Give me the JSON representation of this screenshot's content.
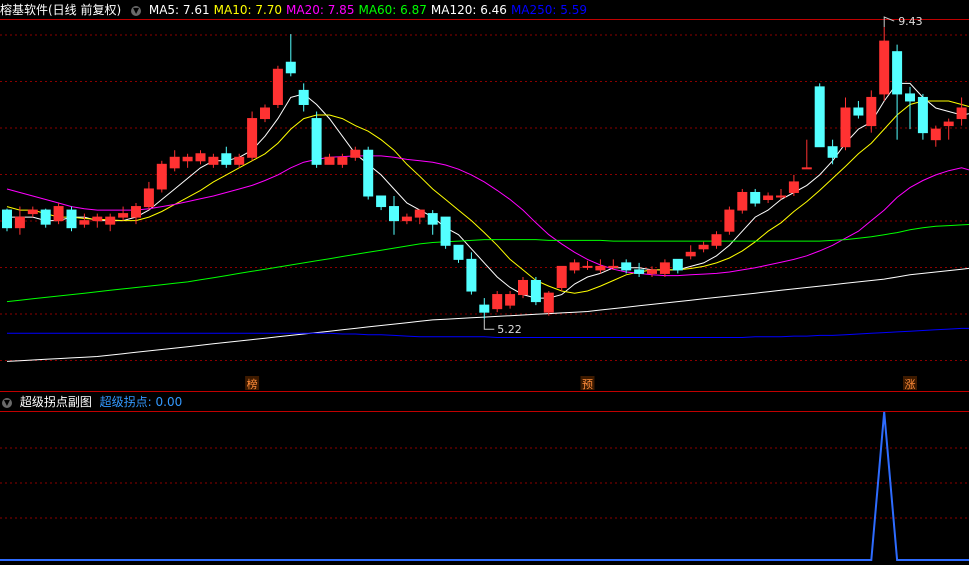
{
  "main_header": {
    "title": "榕基软件(日线 前复权)",
    "ma": [
      {
        "label": "MA5: 7.61",
        "color": "#ffffff"
      },
      {
        "label": "MA10: 7.70",
        "color": "#ffff00"
      },
      {
        "label": "MA20: 7.85",
        "color": "#ff00ff"
      },
      {
        "label": "MA60: 6.87",
        "color": "#00ff00"
      },
      {
        "label": "MA120: 6.46",
        "color": "#ffffff"
      },
      {
        "label": "MA250: 5.59",
        "color": "#0000ff"
      }
    ]
  },
  "sub_header": {
    "title": "超级拐点副图",
    "indicator": "超级拐点: 0.00",
    "indicator_color": "#3399ff"
  },
  "annotations": {
    "high_label": "9.43",
    "low_label": "5.22",
    "markers": [
      "榜",
      "预",
      "涨"
    ]
  },
  "colors": {
    "up": "#ff3232",
    "down": "#54ffff",
    "grid": "#8b0000",
    "divider": "#c00000",
    "marker_bg": "#3d1a00",
    "marker_text": "#ff8c3a",
    "indicator_line": "#2e6cff"
  },
  "chart_data": {
    "type": "candlestick",
    "y_scale": {
      "top_price": 10.0,
      "bottom_price": 5.0
    },
    "candles": [
      [
        7.3,
        7.05,
        7.32,
        7.0
      ],
      [
        7.05,
        7.2,
        7.35,
        6.95
      ],
      [
        7.25,
        7.3,
        7.35,
        7.2
      ],
      [
        7.3,
        7.1,
        7.32,
        7.05
      ],
      [
        7.15,
        7.35,
        7.4,
        7.1
      ],
      [
        7.3,
        7.05,
        7.35,
        7.0
      ],
      [
        7.1,
        7.15,
        7.25,
        7.05
      ],
      [
        7.15,
        7.2,
        7.25,
        7.05
      ],
      [
        7.1,
        7.2,
        7.25,
        7.0
      ],
      [
        7.2,
        7.25,
        7.35,
        7.15
      ],
      [
        7.2,
        7.35,
        7.4,
        7.1
      ],
      [
        7.35,
        7.6,
        7.7,
        7.3
      ],
      [
        7.6,
        7.95,
        8.0,
        7.55
      ],
      [
        7.9,
        8.05,
        8.15,
        7.85
      ],
      [
        8.0,
        8.05,
        8.1,
        7.9
      ],
      [
        8.0,
        8.1,
        8.15,
        7.95
      ],
      [
        7.95,
        8.05,
        8.1,
        7.9
      ],
      [
        8.1,
        7.95,
        8.2,
        7.9
      ],
      [
        7.95,
        8.05,
        8.1,
        7.9
      ],
      [
        8.05,
        8.6,
        8.7,
        8.0
      ],
      [
        8.6,
        8.75,
        8.8,
        8.55
      ],
      [
        8.8,
        9.3,
        9.35,
        8.75
      ],
      [
        9.4,
        9.25,
        9.8,
        9.2
      ],
      [
        9.0,
        8.8,
        9.1,
        8.7
      ],
      [
        8.6,
        7.95,
        8.7,
        7.9
      ],
      [
        7.95,
        8.05,
        8.1,
        7.95
      ],
      [
        7.95,
        8.05,
        8.1,
        7.9
      ],
      [
        8.05,
        8.15,
        8.2,
        8.0
      ],
      [
        8.15,
        7.5,
        8.2,
        7.45
      ],
      [
        7.5,
        7.35,
        7.5,
        7.3
      ],
      [
        7.35,
        7.15,
        7.5,
        6.95
      ],
      [
        7.15,
        7.2,
        7.25,
        7.1
      ],
      [
        7.2,
        7.3,
        7.3,
        7.1
      ],
      [
        7.25,
        7.1,
        7.3,
        6.95
      ],
      [
        7.2,
        6.8,
        7.2,
        6.75
      ],
      [
        6.8,
        6.6,
        6.8,
        6.55
      ],
      [
        6.6,
        6.15,
        6.7,
        6.1
      ],
      [
        5.95,
        5.85,
        6.05,
        5.75
      ],
      [
        5.9,
        6.1,
        6.15,
        5.85
      ],
      [
        5.95,
        6.1,
        6.15,
        5.9
      ],
      [
        6.1,
        6.3,
        6.35,
        6.05
      ],
      [
        6.3,
        6.0,
        6.35,
        5.95
      ],
      [
        5.85,
        6.12,
        6.15,
        5.8
      ],
      [
        6.2,
        6.5,
        6.5,
        6.15
      ],
      [
        6.45,
        6.55,
        6.6,
        6.4
      ],
      [
        6.5,
        6.5,
        6.58,
        6.45
      ],
      [
        6.45,
        6.5,
        6.6,
        6.4
      ],
      [
        6.5,
        6.5,
        6.6,
        6.45
      ],
      [
        6.55,
        6.45,
        6.6,
        6.4
      ],
      [
        6.45,
        6.4,
        6.55,
        6.35
      ],
      [
        6.4,
        6.45,
        6.5,
        6.35
      ],
      [
        6.4,
        6.55,
        6.6,
        6.35
      ],
      [
        6.6,
        6.45,
        6.6,
        6.4
      ],
      [
        6.65,
        6.7,
        6.8,
        6.6
      ],
      [
        6.75,
        6.8,
        6.85,
        6.7
      ],
      [
        6.8,
        6.95,
        7.0,
        6.75
      ],
      [
        7.0,
        7.3,
        7.35,
        6.95
      ],
      [
        7.3,
        7.55,
        7.6,
        7.25
      ],
      [
        7.55,
        7.4,
        7.6,
        7.35
      ],
      [
        7.45,
        7.5,
        7.55,
        7.4
      ],
      [
        7.5,
        7.5,
        7.6,
        7.45
      ],
      [
        7.55,
        7.7,
        7.8,
        7.5
      ],
      [
        7.9,
        7.9,
        8.3,
        7.9
      ],
      [
        9.05,
        8.2,
        9.1,
        8.2
      ],
      [
        8.2,
        8.05,
        8.3,
        7.95
      ],
      [
        8.2,
        8.75,
        8.9,
        8.15
      ],
      [
        8.75,
        8.65,
        8.85,
        8.6
      ],
      [
        8.5,
        8.9,
        9.0,
        8.4
      ],
      [
        8.95,
        9.7,
        9.9,
        8.85
      ],
      [
        9.55,
        8.95,
        9.65,
        8.3
      ],
      [
        8.95,
        8.85,
        9.05,
        8.45
      ],
      [
        8.9,
        8.4,
        8.95,
        8.3
      ],
      [
        8.3,
        8.45,
        8.5,
        8.2
      ],
      [
        8.5,
        8.55,
        8.6,
        8.3
      ],
      [
        8.6,
        8.75,
        8.9,
        8.5
      ],
      [
        8.75,
        8.8,
        8.95,
        8.55
      ]
    ],
    "ma_lines": {
      "MA5": [
        7.2,
        7.2,
        7.2,
        7.15,
        7.15,
        7.2,
        7.2,
        7.15,
        7.15,
        7.15,
        7.2,
        7.3,
        7.45,
        7.6,
        7.75,
        7.9,
        8.0,
        8.0,
        8.05,
        8.15,
        8.35,
        8.6,
        8.9,
        8.95,
        8.8,
        8.6,
        8.35,
        8.1,
        7.95,
        7.8,
        7.6,
        7.4,
        7.3,
        7.2,
        7.05,
        6.95,
        6.75,
        6.55,
        6.35,
        6.2,
        6.1,
        6.05,
        6.05,
        6.1,
        6.25,
        6.35,
        6.4,
        6.48,
        6.48,
        6.48,
        6.45,
        6.45,
        6.45,
        6.5,
        6.55,
        6.65,
        6.8,
        7.0,
        7.2,
        7.3,
        7.45,
        7.55,
        7.65,
        7.8,
        8.0,
        8.25,
        8.45,
        8.55,
        8.85,
        9.1,
        9.1,
        8.9,
        8.75,
        8.7,
        8.65,
        8.68
      ],
      "MA10": [
        7.35,
        7.3,
        7.3,
        7.25,
        7.2,
        7.2,
        7.18,
        7.17,
        7.16,
        7.15,
        7.15,
        7.2,
        7.28,
        7.38,
        7.48,
        7.58,
        7.7,
        7.8,
        7.9,
        8.0,
        8.1,
        8.25,
        8.45,
        8.6,
        8.65,
        8.65,
        8.6,
        8.5,
        8.42,
        8.3,
        8.15,
        7.95,
        7.78,
        7.6,
        7.45,
        7.3,
        7.15,
        6.98,
        6.8,
        6.6,
        6.45,
        6.3,
        6.22,
        6.15,
        6.12,
        6.15,
        6.22,
        6.3,
        6.38,
        6.42,
        6.45,
        6.45,
        6.45,
        6.47,
        6.5,
        6.55,
        6.62,
        6.72,
        6.85,
        7.0,
        7.12,
        7.28,
        7.42,
        7.58,
        7.75,
        7.92,
        8.1,
        8.25,
        8.45,
        8.65,
        8.8,
        8.85,
        8.85,
        8.85,
        8.8,
        8.75
      ],
      "MA20": [
        7.6,
        7.55,
        7.5,
        7.45,
        7.4,
        7.35,
        7.32,
        7.3,
        7.3,
        7.3,
        7.3,
        7.32,
        7.35,
        7.38,
        7.42,
        7.46,
        7.5,
        7.55,
        7.6,
        7.65,
        7.72,
        7.8,
        7.9,
        7.98,
        8.02,
        8.05,
        8.06,
        8.07,
        8.07,
        8.07,
        8.05,
        8.02,
        8.0,
        7.98,
        7.94,
        7.88,
        7.8,
        7.7,
        7.58,
        7.45,
        7.3,
        7.12,
        6.95,
        6.82,
        6.7,
        6.6,
        6.52,
        6.46,
        6.42,
        6.4,
        6.38,
        6.37,
        6.37,
        6.38,
        6.39,
        6.4,
        6.42,
        6.45,
        6.48,
        6.52,
        6.56,
        6.6,
        6.65,
        6.72,
        6.8,
        6.9,
        7.0,
        7.15,
        7.3,
        7.48,
        7.62,
        7.72,
        7.8,
        7.86,
        7.9,
        7.85
      ],
      "MA60": [
        6.0,
        6.02,
        6.04,
        6.06,
        6.08,
        6.1,
        6.12,
        6.14,
        6.16,
        6.18,
        6.2,
        6.22,
        6.24,
        6.26,
        6.28,
        6.31,
        6.34,
        6.37,
        6.4,
        6.43,
        6.46,
        6.49,
        6.52,
        6.55,
        6.58,
        6.61,
        6.64,
        6.67,
        6.7,
        6.73,
        6.76,
        6.79,
        6.82,
        6.84,
        6.85,
        6.86,
        6.87,
        6.88,
        6.88,
        6.88,
        6.88,
        6.88,
        6.87,
        6.87,
        6.87,
        6.87,
        6.87,
        6.86,
        6.86,
        6.86,
        6.86,
        6.86,
        6.86,
        6.86,
        6.86,
        6.86,
        6.86,
        6.86,
        6.86,
        6.86,
        6.86,
        6.86,
        6.86,
        6.86,
        6.87,
        6.88,
        6.9,
        6.92,
        6.95,
        6.98,
        7.02,
        7.05,
        7.07,
        7.08,
        7.09,
        7.1
      ],
      "MA120": [
        5.15,
        5.16,
        5.17,
        5.18,
        5.19,
        5.2,
        5.21,
        5.22,
        5.24,
        5.26,
        5.28,
        5.3,
        5.32,
        5.34,
        5.36,
        5.38,
        5.4,
        5.42,
        5.44,
        5.46,
        5.48,
        5.5,
        5.52,
        5.54,
        5.56,
        5.58,
        5.6,
        5.62,
        5.64,
        5.66,
        5.68,
        5.7,
        5.72,
        5.74,
        5.75,
        5.76,
        5.77,
        5.78,
        5.79,
        5.8,
        5.81,
        5.82,
        5.83,
        5.84,
        5.85,
        5.86,
        5.88,
        5.9,
        5.92,
        5.94,
        5.96,
        5.98,
        6.0,
        6.02,
        6.04,
        6.06,
        6.08,
        6.1,
        6.12,
        6.14,
        6.16,
        6.18,
        6.2,
        6.22,
        6.24,
        6.26,
        6.28,
        6.3,
        6.32,
        6.35,
        6.38,
        6.4,
        6.42,
        6.44,
        6.46,
        6.48
      ],
      "MA250": [
        5.55,
        5.55,
        5.55,
        5.55,
        5.55,
        5.55,
        5.55,
        5.55,
        5.55,
        5.55,
        5.55,
        5.55,
        5.55,
        5.55,
        5.55,
        5.55,
        5.55,
        5.55,
        5.55,
        5.55,
        5.55,
        5.55,
        5.55,
        5.55,
        5.55,
        5.55,
        5.54,
        5.54,
        5.53,
        5.53,
        5.52,
        5.51,
        5.5,
        5.5,
        5.5,
        5.5,
        5.5,
        5.5,
        5.49,
        5.49,
        5.49,
        5.49,
        5.49,
        5.49,
        5.49,
        5.49,
        5.49,
        5.49,
        5.49,
        5.49,
        5.49,
        5.49,
        5.49,
        5.49,
        5.49,
        5.49,
        5.49,
        5.49,
        5.5,
        5.5,
        5.5,
        5.51,
        5.51,
        5.52,
        5.52,
        5.53,
        5.54,
        5.55,
        5.56,
        5.57,
        5.58,
        5.59,
        5.6,
        5.61,
        5.62,
        5.62
      ]
    },
    "ma_colors": {
      "MA5": "#ffffff",
      "MA10": "#ffff00",
      "MA20": "#ff00ff",
      "MA60": "#00ff00",
      "MA120": "#ffffff",
      "MA250": "#0000ff"
    },
    "marker_candle_index": [
      19,
      45,
      70
    ],
    "high_candle_index": 68,
    "low_candle_index": 37,
    "sub_indicator": {
      "name": "超级拐点",
      "values": [
        0,
        0,
        0,
        0,
        0,
        0,
        0,
        0,
        0,
        0,
        0,
        0,
        0,
        0,
        0,
        0,
        0,
        0,
        0,
        0,
        0,
        0,
        0,
        0,
        0,
        0,
        0,
        0,
        0,
        0,
        0,
        0,
        0,
        0,
        0,
        0,
        0,
        0,
        0,
        0,
        0,
        0,
        0,
        0,
        0,
        0,
        0,
        0,
        0,
        0,
        0,
        0,
        0,
        0,
        0,
        0,
        0,
        0,
        0,
        0,
        0,
        0,
        0,
        0,
        0,
        0,
        0,
        0,
        1,
        0,
        0,
        0,
        0,
        0,
        0,
        0
      ],
      "ylim": [
        0,
        1
      ]
    }
  }
}
